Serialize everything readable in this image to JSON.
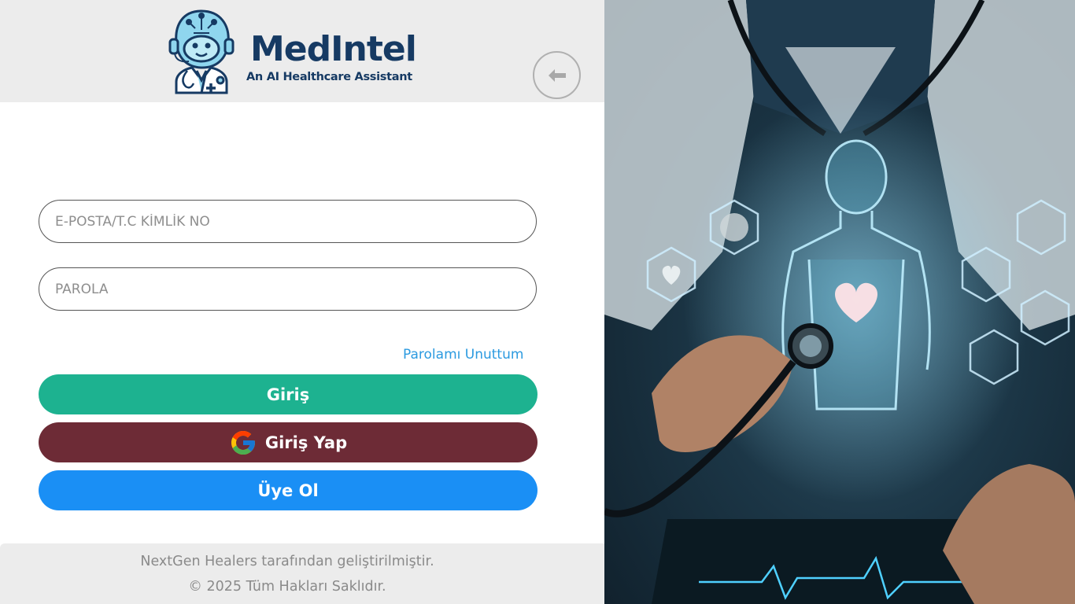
{
  "brand": {
    "title": "MedIntel",
    "subtitle": "An AI Healthcare Assistant",
    "logo_icon": "doctor-robot-icon"
  },
  "header": {
    "back_icon": "arrow-left-icon"
  },
  "form": {
    "email_placeholder": "E-POSTA/T.C KİMLİK NO",
    "email_value": "",
    "password_placeholder": "PAROLA",
    "password_value": "",
    "forgot_label": "Parolamı Unuttum"
  },
  "buttons": {
    "login_label": "Giriş",
    "google_label": "Giriş Yap",
    "google_icon": "google-icon",
    "signup_label": "Üye Ol"
  },
  "footer": {
    "credit": "NextGen Healers tarafından geliştirilmiştir.",
    "copyright": "© 2025 Tüm Hakları Saklıdır."
  },
  "colors": {
    "brand_navy": "#163a63",
    "login_green": "#1db290",
    "google_maroon": "#6d2b36",
    "signup_blue": "#1a8ff5",
    "link_blue": "#2b9ae0",
    "header_gray": "#ececec"
  }
}
